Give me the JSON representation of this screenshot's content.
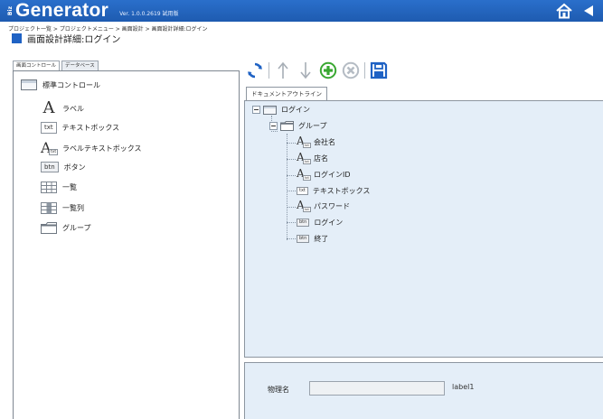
{
  "app": {
    "brand_prefix": "Biz",
    "brand_name": "Generator",
    "version": "Ver. 1.0.0.2619 試用版"
  },
  "header": {
    "breadcrumb": "プロジェクト一覧 > プロジェクトメニュー > 画面設計 > 画面設計詳細:ログイン",
    "title": "画面設計詳細:ログイン"
  },
  "left_tabs": [
    {
      "label": "画面コントロール"
    },
    {
      "label": "データベース"
    }
  ],
  "components": [
    {
      "label": "標準コントロール",
      "icon": "standard-control-icon"
    },
    {
      "label": "ラベル",
      "icon": "label-icon"
    },
    {
      "label": "テキストボックス",
      "icon": "textbox-icon"
    },
    {
      "label": "ラベルテキストボックス",
      "icon": "label-textbox-icon"
    },
    {
      "label": "ボタン",
      "icon": "button-icon"
    },
    {
      "label": "一覧",
      "icon": "list-icon"
    },
    {
      "label": "一覧列",
      "icon": "list-column-icon"
    },
    {
      "label": "グループ",
      "icon": "group-icon"
    }
  ],
  "icon_text": {
    "label_glyph": "A",
    "txt": "txt",
    "btn": "btn"
  },
  "toolbar": {
    "items": [
      "refresh-icon",
      "move-up-icon",
      "move-down-icon",
      "add-icon",
      "delete-icon",
      "save-icon"
    ]
  },
  "outline": {
    "tab_label": "ドキュメントアウトライン",
    "root": {
      "label": "ログイン"
    },
    "group": {
      "label": "グループ"
    },
    "children": [
      {
        "label": "会社名",
        "type": "label-textbox"
      },
      {
        "label": "店名",
        "type": "label-textbox"
      },
      {
        "label": "ログインID",
        "type": "label-textbox"
      },
      {
        "label": "テキストボックス",
        "type": "textbox"
      },
      {
        "label": "パスワード",
        "type": "label-textbox"
      },
      {
        "label": "ログイン",
        "type": "button"
      },
      {
        "label": "終了",
        "type": "button"
      }
    ]
  },
  "properties": {
    "physical_name_label": "物理名",
    "physical_name_value": "",
    "control_id": "label1"
  },
  "colors": {
    "titlebar": "#1e5bb0",
    "accent": "#1f62c4",
    "outline_bg": "#e4eef8",
    "add_green": "#3aa832"
  }
}
